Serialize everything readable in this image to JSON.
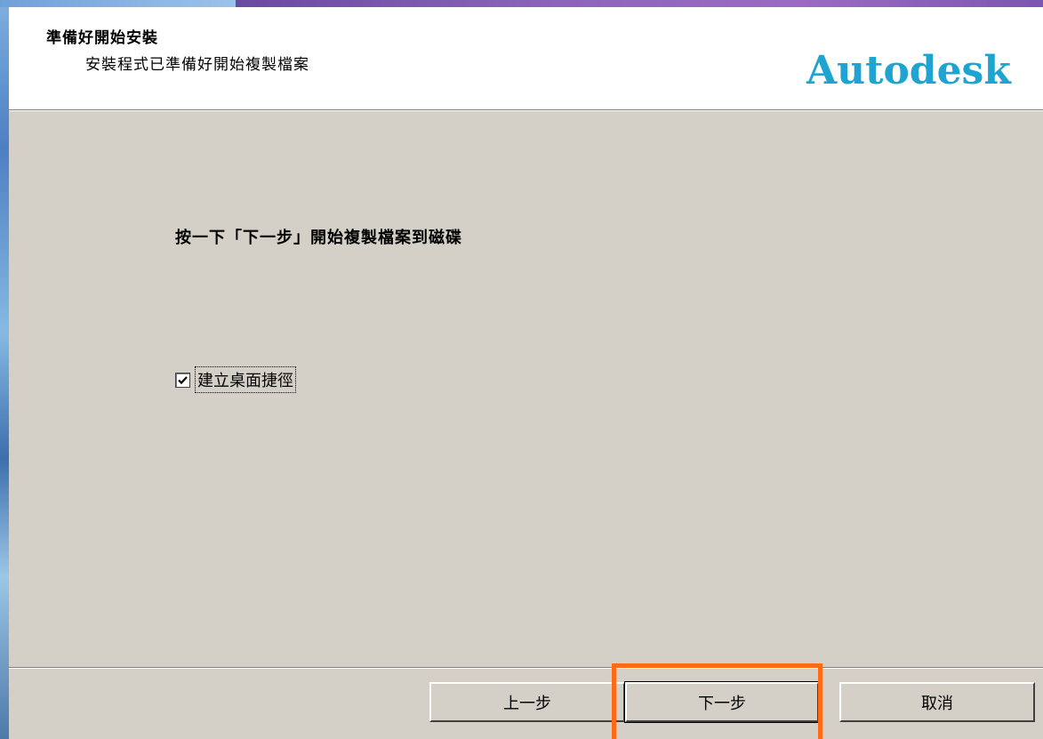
{
  "header": {
    "title": "準備好開始安裝",
    "subtitle": "安裝程式已準備好開始複製檔案",
    "logo_text": "Autodesk"
  },
  "main": {
    "instruction": "按一下「下一步」開始複製檔案到磁碟",
    "checkbox": {
      "label": "建立桌面捷徑",
      "checked": true
    }
  },
  "buttons": {
    "back_label": "上一步",
    "next_label": "下一步",
    "cancel_label": "取消"
  },
  "colors": {
    "logo": "#1fa3d0",
    "dialog_bg": "#d4d0c8",
    "highlight": "#ff6a13"
  }
}
